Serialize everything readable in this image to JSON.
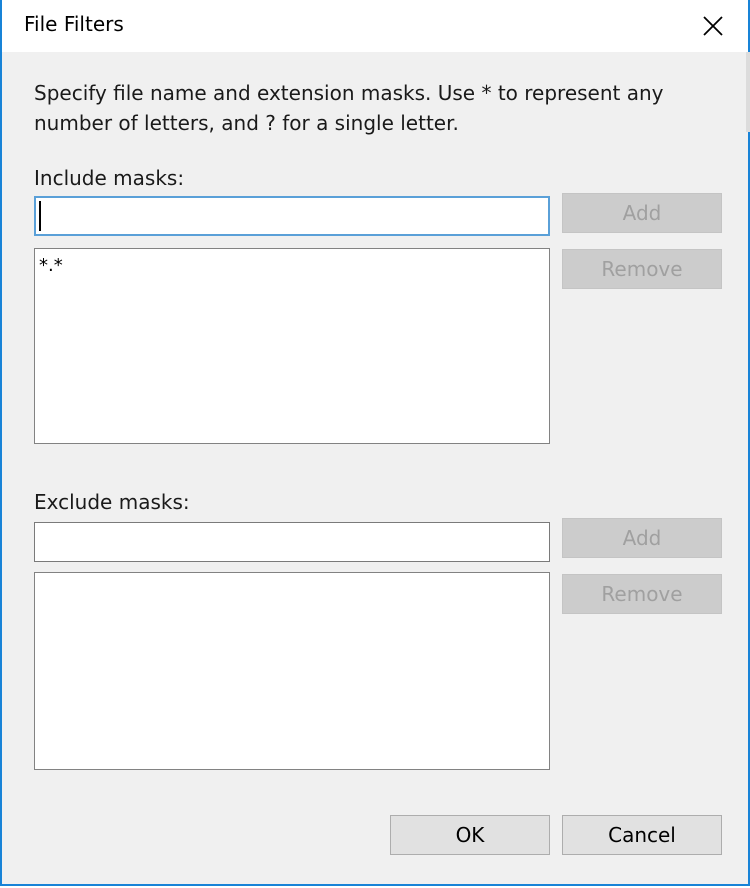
{
  "window": {
    "title": "File Filters"
  },
  "description": "Specify file name and extension masks. Use * to represent any number of letters, and ? for a single letter.",
  "include": {
    "label": "Include masks:",
    "input_value": "",
    "items": [
      "*.*"
    ],
    "add_label": "Add",
    "remove_label": "Remove"
  },
  "exclude": {
    "label": "Exclude masks:",
    "input_value": "",
    "items": [],
    "add_label": "Add",
    "remove_label": "Remove"
  },
  "footer": {
    "ok_label": "OK",
    "cancel_label": "Cancel"
  },
  "icons": {
    "close": "close-icon"
  },
  "colors": {
    "window_border": "#1883d7",
    "focus_border": "#5aa0d8",
    "dialog_background": "#f0f0f0"
  }
}
